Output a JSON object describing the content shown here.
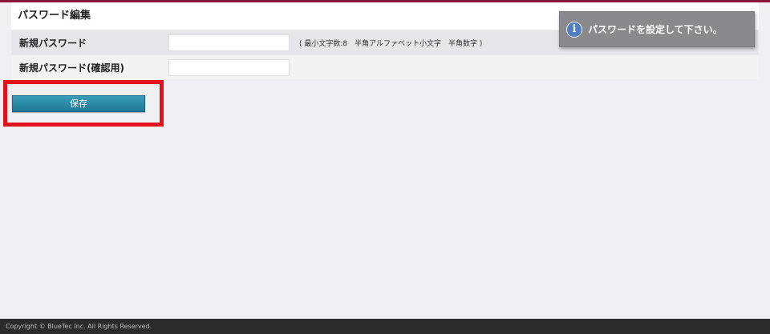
{
  "panel": {
    "title": "パスワード編集",
    "rows": [
      {
        "label": "新規パスワード",
        "value": "",
        "hint": "( 最小文字数:8　半角アルファベット小文字　半角数字 )"
      },
      {
        "label": "新規パスワード(確認用)",
        "value": ""
      }
    ]
  },
  "save": {
    "label": "保存"
  },
  "toast": {
    "icon": "info-icon",
    "message": "パスワードを設定して下さい。"
  },
  "footer": {
    "copyright": "Copyright © BlueTec Inc. All Rights Reserved."
  },
  "colors": {
    "accent": "#8a1538",
    "button": "#2b8aa6",
    "highlight": "#e3101e",
    "toast": "#8a8a8c",
    "footer": "#2b2b2b"
  }
}
